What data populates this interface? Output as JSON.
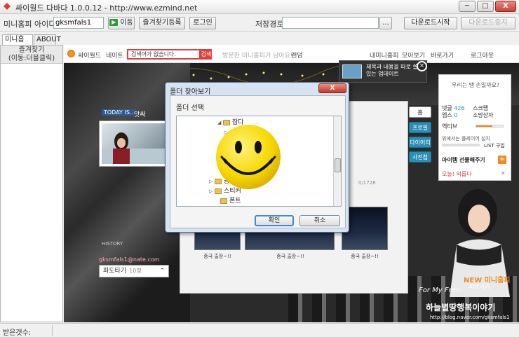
{
  "window": {
    "title": "싸이월드 다바다 1.0.0.12 - http://www.ezmind.net",
    "min": "─",
    "max": "□",
    "close": "X"
  },
  "toolbar": {
    "id_label": "미니홈피 아이디",
    "id_value": "gksmfals1",
    "move_btn": "이동",
    "fav_btn": "즐겨찾기등록",
    "login_btn": "로그인",
    "save_path_label": "저장경로",
    "save_path_value": "",
    "browse_btn": "...",
    "download_start_btn": "다운로드시작",
    "download_stop_btn": "다운로드중지"
  },
  "tabs": [
    {
      "label": "미니홈피"
    },
    {
      "label": "ABOUT"
    }
  ],
  "left_panel": {
    "header_line1": "즐겨찾기",
    "header_line2": "(이동:더블클릭)"
  },
  "status": {
    "label": "받은갯수:"
  },
  "site_nav": {
    "cyworld": "싸이월드",
    "nate": "네이트",
    "search_placeholder": "검색어가 없습니다.",
    "search_btn": "검색",
    "visited": "방문한 미니홈피가 남아요!",
    "random": "랜덤",
    "my_minihome": "내미니홈피",
    "collection": "모아보기",
    "shortcut": "바로가기",
    "logout": "로그아웃"
  },
  "minihome": {
    "today_badge": "TODAY IS..",
    "mood": "앗싸",
    "history": "HISTORY",
    "email": "gksmfals1@nate.com",
    "padotagi": "파도타기",
    "padotagi_count": "10명",
    "center_captions": [
      "중국 출장~!!",
      "중국 출장~!!",
      "중국 출장~!!"
    ],
    "page_indicator": "0/1728",
    "menu_tabs": [
      "홈",
      "프로필",
      "다이어리",
      "사진첩"
    ],
    "right_panel": {
      "line1": "우리는 맹 손일까요?",
      "comment_label": "댓글",
      "comment_count": "426",
      "scrap_label": "스크랩",
      "applause_label": "앱스",
      "applause_count": "0",
      "sogamang": "소망상자",
      "activity": "액티브",
      "music_bar": "위에서는 플레이어 설치",
      "list": "LIST",
      "buy": "구입",
      "item_gift": "아이템 선물해주기",
      "todays_words": "오늘! 외롭다"
    },
    "popup": "제목과 내용을 따로 쓸 수 있는 업데이트",
    "popup_close": "×",
    "new_minihome": "NEW 미니홈피",
    "shortcut2": "바로가기",
    "for_my_fren": "For My Fren",
    "signature": "하늘별땅행복이야기",
    "blog_url": "http://blog.naver.com/gksmfals1"
  },
  "dialog": {
    "title": "폴더 찾아보기",
    "close": "X",
    "subtitle": "폴더 선택",
    "tree": [
      {
        "label": "잡다",
        "expanded": true
      },
      {
        "label": "",
        "expanded": false
      },
      {
        "label": "",
        "expanded": false
      },
      {
        "label": "",
        "expanded": false
      },
      {
        "label": "공",
        "expanded": false
      },
      {
        "label": "스티커",
        "expanded": false
      },
      {
        "label": "폰트",
        "expanded": false
      }
    ],
    "ok_btn": "확인",
    "cancel_btn": "취소"
  },
  "colors": {
    "accent_red": "#e0403a",
    "tab_blue": "#2a8fb5",
    "folder_yellow": "#e8c25a"
  }
}
